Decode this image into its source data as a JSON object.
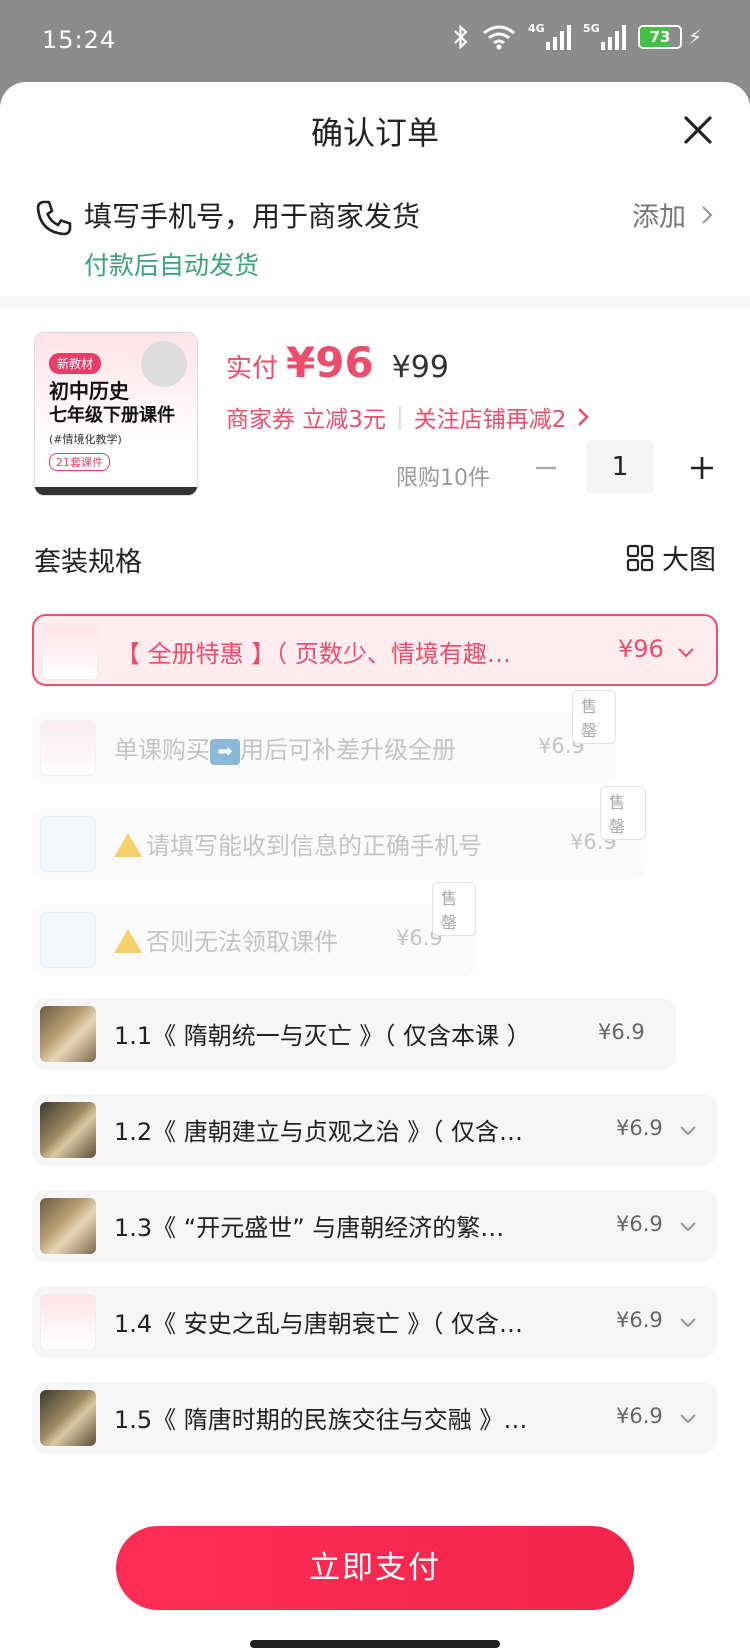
{
  "status": {
    "time": "15:24",
    "net1": "4G",
    "net2": "5G",
    "battery": "73",
    "battery_level": 0.73
  },
  "header": {
    "title": "确认订单"
  },
  "contact": {
    "hint": "填写手机号，用于商家发货",
    "add_label": "添加",
    "sub": "付款后自动发货"
  },
  "product": {
    "thumb": {
      "badge": "新教材",
      "line1": "初中历史",
      "line2": "七年级下册课件",
      "line3": "(#情境化教学)",
      "line4": "21套课件"
    },
    "price_label": "实付",
    "price_now": "¥96",
    "price_orig": "¥99",
    "coupon": "商家券 立减3元",
    "follow": "关注店铺再减2",
    "limit": "限购10件",
    "quantity": "1"
  },
  "spec": {
    "title": "套装规格",
    "big_label": "大图",
    "options": [
      {
        "text": "【 全册特惠 】（ 页数少、情境有趣…",
        "price": "¥96"
      },
      {
        "text_a": "单课购买",
        "text_b": "用后可补差升级全册",
        "price": "¥6.9",
        "sold": "售罄"
      },
      {
        "text": "请填写能收到信息的正确手机号",
        "price": "¥6.9",
        "sold": "售罄"
      },
      {
        "text": "否则无法领取课件",
        "price": "¥6.9",
        "sold": "售罄"
      },
      {
        "text": "1.1《 隋朝统一与灭亡 》（ 仅含本课 ）",
        "price": "¥6.9"
      },
      {
        "text": "1.2《 唐朝建立与贞观之治 》（ 仅含…",
        "price": "¥6.9"
      },
      {
        "text": "1.3《 “开元盛世” 与唐朝经济的繁…",
        "price": "¥6.9"
      },
      {
        "text": "1.4《 安史之乱与唐朝衰亡 》（ 仅含…",
        "price": "¥6.9"
      },
      {
        "text": "1.5《 隋唐时期的民族交往与交融 》…",
        "price": "¥6.9"
      }
    ]
  },
  "footer": {
    "pay_label": "立即支付"
  },
  "colors": {
    "accent": "#ec4d6b",
    "pay": "#ff2d55",
    "green": "#3aa37a"
  }
}
